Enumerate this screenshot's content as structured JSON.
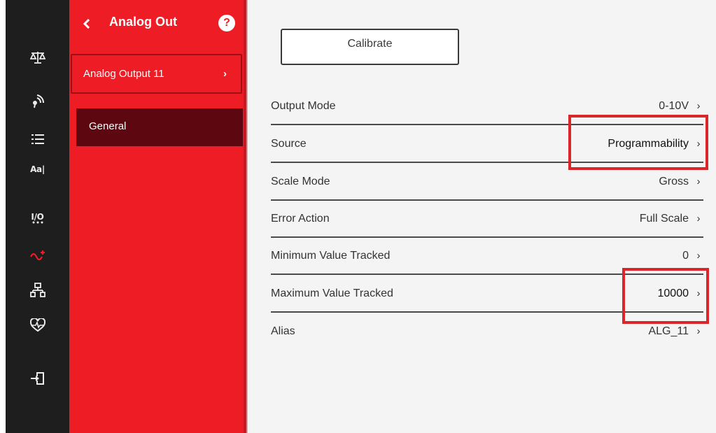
{
  "sidebar_rail": {
    "icons": [
      "scale-icon",
      "wireless-icon",
      "list-icon",
      "font-icon",
      "io-icon",
      "analog-out-icon",
      "network-icon",
      "health-icon",
      "logout-icon"
    ],
    "font_icon_text": "Aa|",
    "io_icon_text": "I/O",
    "active_icon": "analog-out-icon"
  },
  "panel": {
    "title": "Analog Out",
    "back_glyph": "‹",
    "help_glyph": "?",
    "items": [
      {
        "label": "Analog Output 11",
        "chevron": "›"
      },
      {
        "label": "General"
      }
    ]
  },
  "content": {
    "calibrate_label": "Calibrate",
    "chevron": "›",
    "rows": [
      {
        "label": "Output Mode",
        "value": "0-10V"
      },
      {
        "label": "Source",
        "value": "Programmability"
      },
      {
        "label": "Scale Mode",
        "value": "Gross"
      },
      {
        "label": "Error Action",
        "value": "Full Scale"
      },
      {
        "label": "Minimum Value Tracked",
        "value": "0"
      },
      {
        "label": "Maximum Value Tracked",
        "value": "10000"
      },
      {
        "label": "Alias",
        "value": "ALG_11"
      }
    ]
  },
  "colors": {
    "rail_bg": "#1e1e1e",
    "panel_bg": "#ee1c25",
    "selected_item_bg": "#5d0710",
    "content_bg": "#f4f4f4",
    "highlight": "#d9262b",
    "active_icon": "#ee1c25"
  }
}
